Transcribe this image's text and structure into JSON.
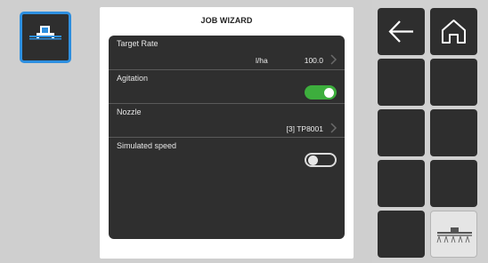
{
  "app_icon": {
    "name": "sprayer-app-icon",
    "accent": "#2d8fe0"
  },
  "wizard": {
    "title": "JOB WIZARD",
    "rows": [
      {
        "label": "Target Rate",
        "unit": "l/ha",
        "value": "100.0"
      },
      {
        "label": "Agitation",
        "toggle": true
      },
      {
        "label": "Nozzle",
        "value": "[3] TP8001"
      },
      {
        "label": "Simulated speed",
        "toggle": false
      }
    ]
  },
  "sidebar": {
    "back_icon": "arrow-left-icon",
    "home_icon": "home-icon",
    "boom_icon": "sprayer-boom-icon"
  },
  "colors": {
    "toggle_on": "#3dae3d",
    "panel_dark": "#2f2f2f",
    "button_dark": "#2e2e2e"
  }
}
